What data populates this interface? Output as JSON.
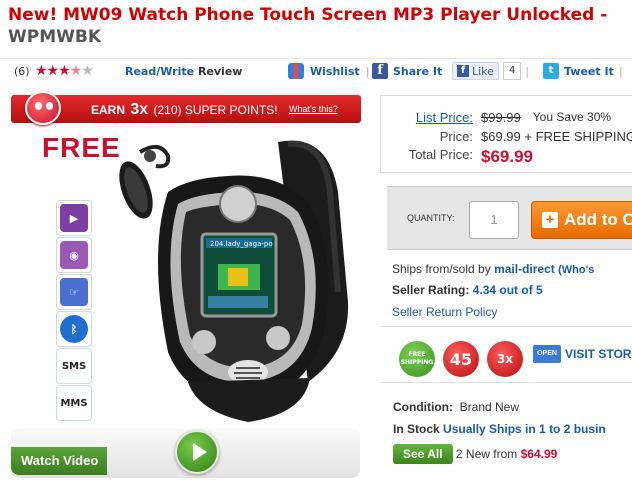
{
  "title": {
    "main": "New! MW09 Watch Phone Touch Screen MP3 Player Unlocked -",
    "brand": "WPMWBK"
  },
  "rating": {
    "count": "(6)",
    "stars": 3.5
  },
  "social": {
    "review_read": "Read/Write",
    "review_label": "Review",
    "wishlist": "Wishlist",
    "share": "Share It",
    "like": "Like",
    "like_count": "4",
    "tweet": "Tweet It"
  },
  "promo": {
    "earn": "EARN",
    "multiplier": "3x",
    "points": "(210) SUPER POINTS!",
    "whats_this": "What's this?",
    "free_label": "FREE"
  },
  "features": [
    {
      "icon": "video-camera-icon",
      "color": "#7b3fa0"
    },
    {
      "icon": "camera-icon",
      "color": "#9b59b6"
    },
    {
      "icon": "touch-screen-icon",
      "color": "#4a6fd0"
    },
    {
      "icon": "bluetooth-icon",
      "color": "#1f6fd1"
    },
    {
      "icon": "sms-icon",
      "text": "SMS"
    },
    {
      "icon": "mms-icon",
      "text": "MMS"
    }
  ],
  "watch_screen_text": "204.lady_gaga-po",
  "video": {
    "label": "Watch Video"
  },
  "pricing": {
    "list_label": "List Price:",
    "list_value": "$99.99",
    "save_text": "You Save 30%",
    "price_label": "Price:",
    "price_value": "$69.99 + FREE SHIPPING",
    "total_label": "Total Price:",
    "total_value": "$69.99"
  },
  "cart": {
    "quantity_label": "QUANTITY:",
    "quantity_value": "1",
    "add_label": "Add to C"
  },
  "seller": {
    "ships_prefix": "Ships from/sold by",
    "seller_name": "mail-direct",
    "whos": "(Who's",
    "rating_label": "Seller Rating:",
    "rating_value": "4.34 out of 5",
    "return_policy": "Seller Return Policy"
  },
  "badges": {
    "free_shipping": "FREE SHIPPING",
    "days": "45",
    "mult": "3x",
    "open": "OPEN",
    "visit_store": "VISIT STORE"
  },
  "condition": {
    "label": "Condition:",
    "value": "Brand New",
    "in_stock": "In Stock",
    "ships": "Usually Ships in 1 to 2 busin",
    "see_all": "See All",
    "new_from": "2 New from",
    "new_price": "$64.99"
  },
  "colors": {
    "accent_red": "#c8102e",
    "link_blue": "#1a5aa8",
    "cart_orange": "#e76b00",
    "green": "#3d851c"
  }
}
